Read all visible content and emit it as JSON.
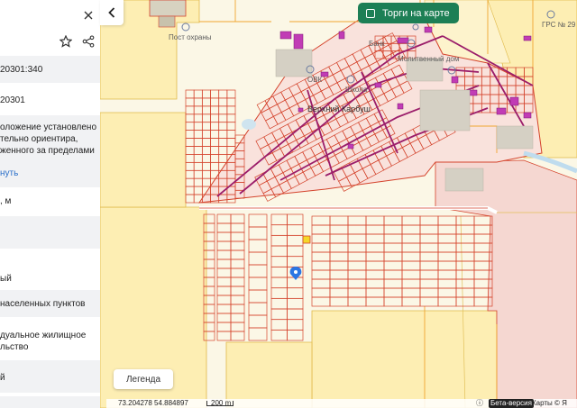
{
  "panel": {
    "close_icon": "close-icon",
    "favorite_icon": "star-icon",
    "share_icon": "share-icon",
    "cadastral_number": "20301:340",
    "quarter_number": "20301",
    "location_lines": [
      "оложение установлено",
      "тельно ориентира,",
      "женного за пределами"
    ],
    "location_link": "нуть",
    "area_label": ", м",
    "category_label": "ый",
    "category_value": "населенных пунктов",
    "use_lines": [
      "дуальное жилищное",
      "льство"
    ],
    "extra_value": "й"
  },
  "collapse_icon": "chevron-left-icon",
  "map": {
    "torgi_label": "Торги на карте",
    "legend_label": "Легенда",
    "labels": {
      "post": "Пост охраны",
      "ovk": "ОВК",
      "gis": "ГРС № 29",
      "bank": "Банк",
      "church": "Молитвенный дом",
      "school": "Школа",
      "village": "Верхний Карбуш"
    },
    "coordinates": "73.204278  54.884897",
    "scale": "200 m",
    "beta": "Бета-версия",
    "attribution": "Карты © Я"
  },
  "colors": {
    "parcel_border": "#d4432c",
    "zone_fill": "#fdeeb3",
    "pink_fill": "#f5d7d1",
    "road": "#9b1d6a",
    "accent_green": "#1d7f55",
    "marker_blue": "#2c76e3"
  }
}
